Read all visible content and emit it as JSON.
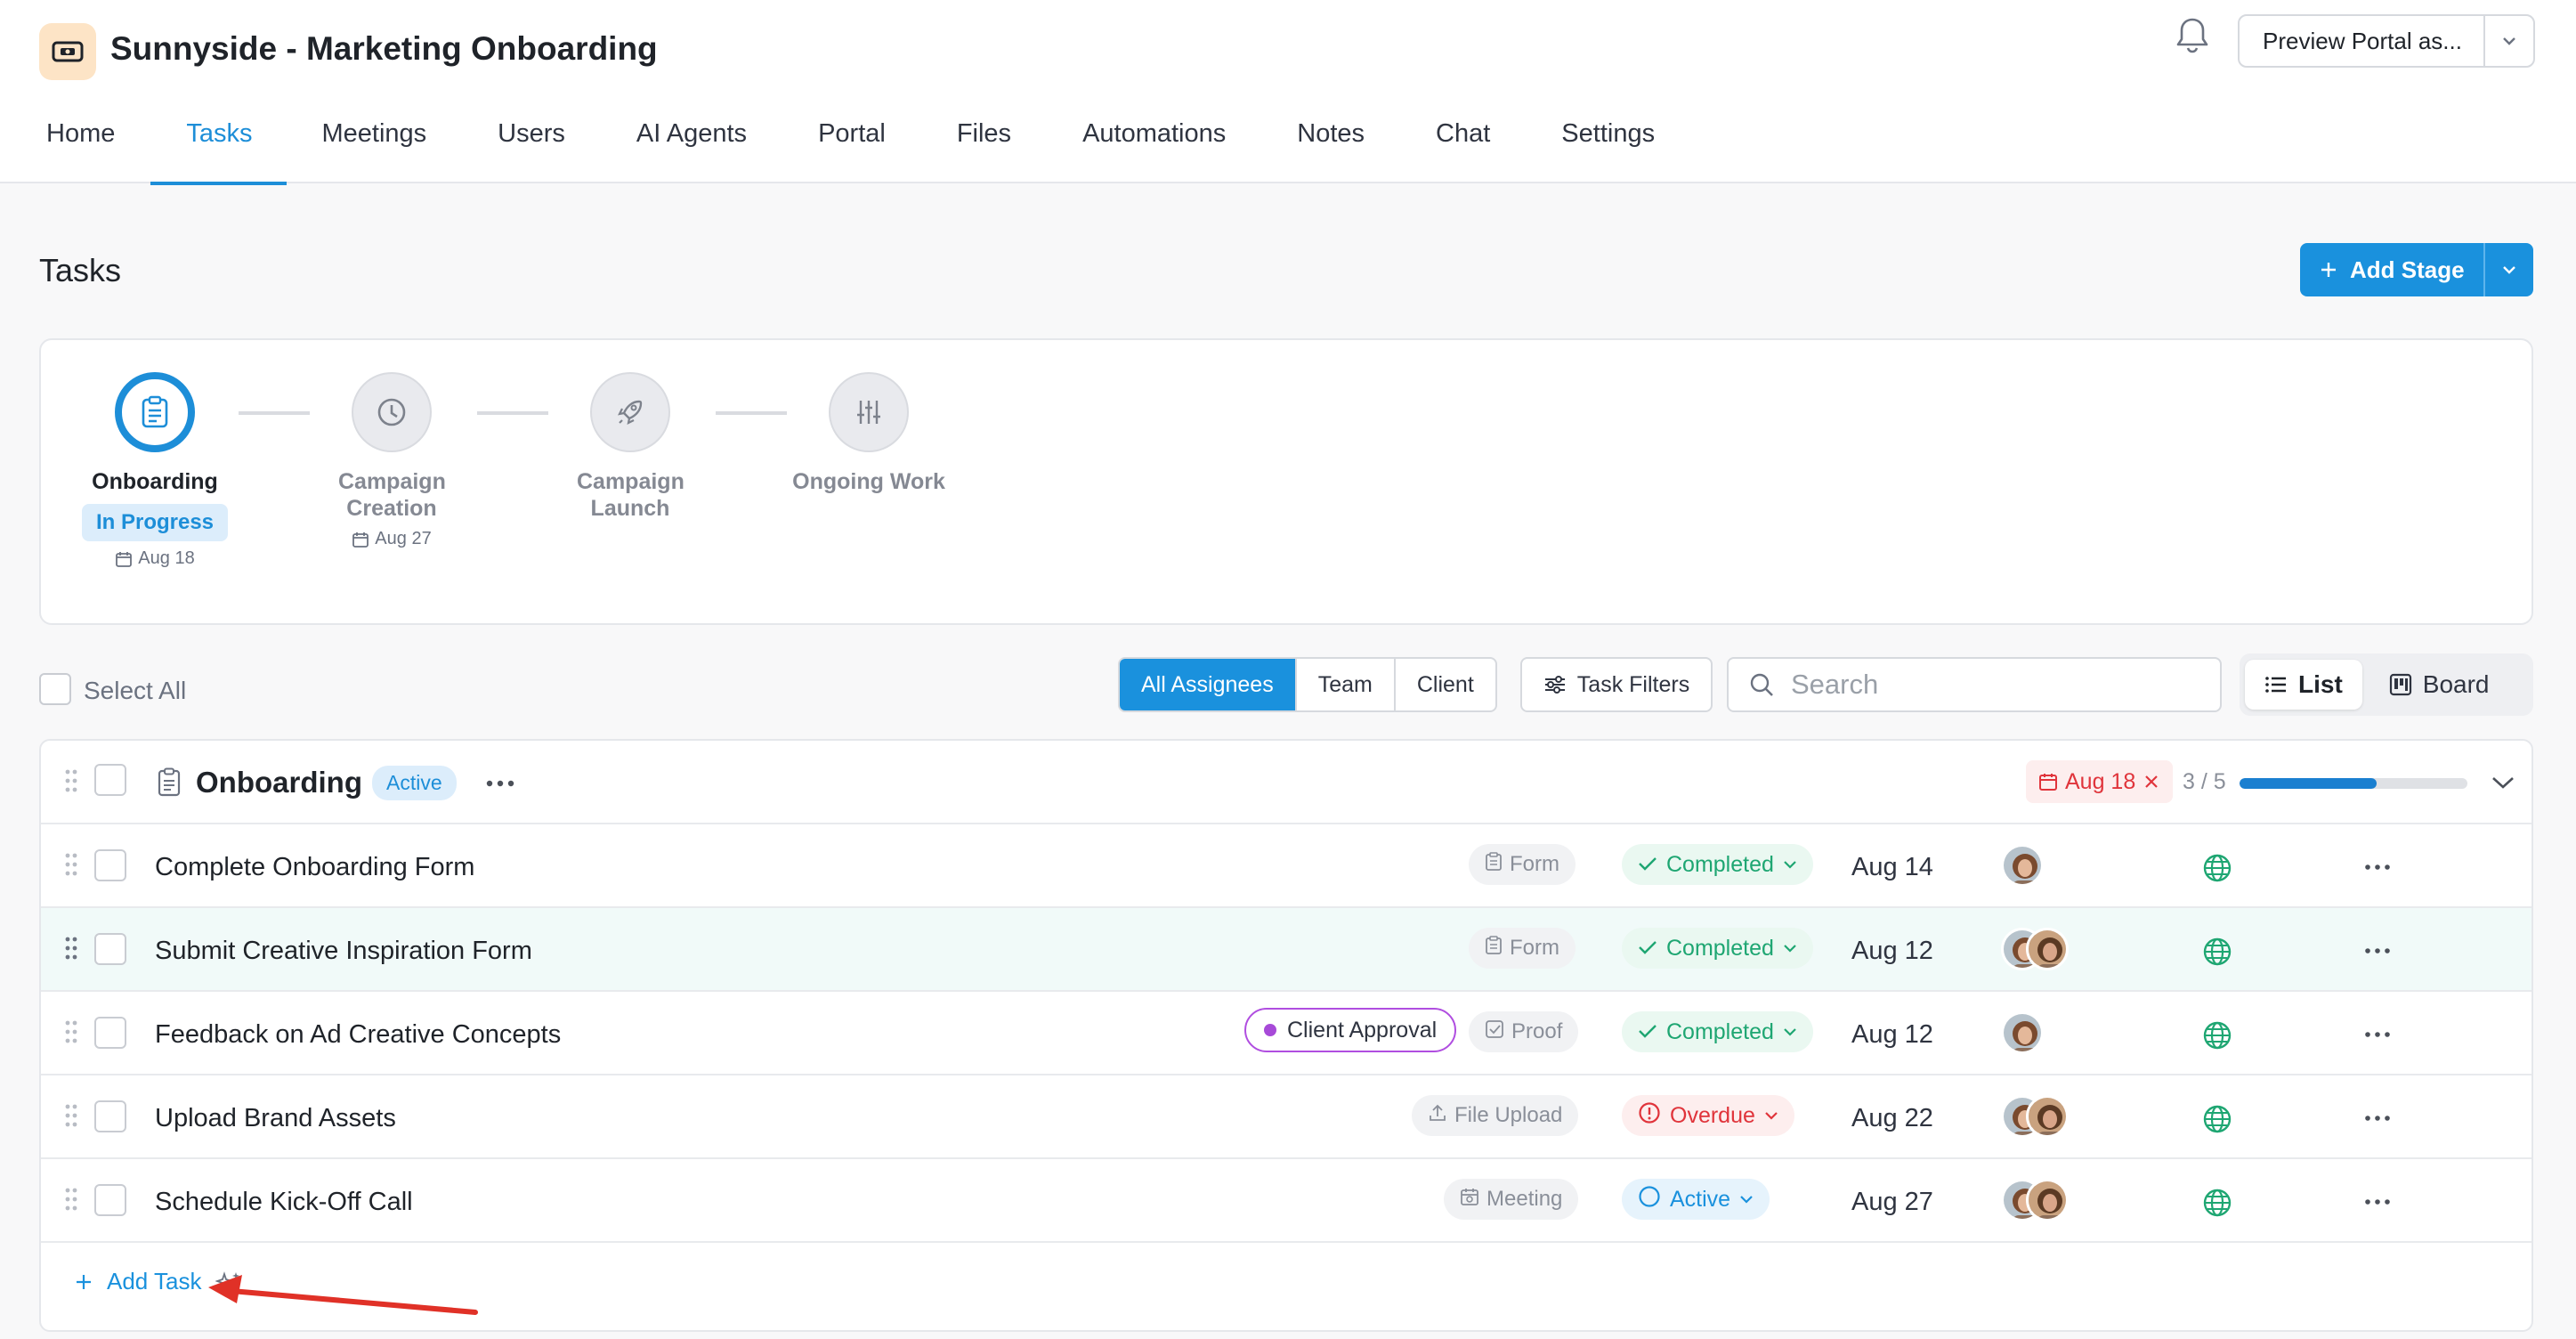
{
  "app": {
    "title": "Sunnyside - Marketing Onboarding"
  },
  "header": {
    "preview_label": "Preview Portal as...",
    "tabs": [
      {
        "label": "Home"
      },
      {
        "label": "Tasks",
        "active": true
      },
      {
        "label": "Meetings"
      },
      {
        "label": "Users"
      },
      {
        "label": "AI Agents"
      },
      {
        "label": "Portal"
      },
      {
        "label": "Files"
      },
      {
        "label": "Automations"
      },
      {
        "label": "Notes"
      },
      {
        "label": "Chat"
      },
      {
        "label": "Settings"
      }
    ]
  },
  "page": {
    "title": "Tasks",
    "add_stage_label": "Add Stage"
  },
  "stages": [
    {
      "name": "Onboarding",
      "status": "In Progress",
      "date": "Aug 18",
      "icon": "clipboard-icon",
      "current": true
    },
    {
      "name": "Campaign Creation",
      "date": "Aug 27",
      "icon": "clock-icon"
    },
    {
      "name": "Campaign Launch",
      "icon": "rocket-icon"
    },
    {
      "name": "Ongoing Work",
      "icon": "sliders-icon"
    }
  ],
  "toolbar": {
    "select_all": "Select All",
    "assignee_filters": [
      "All Assignees",
      "Team",
      "Client"
    ],
    "task_filters_label": "Task Filters",
    "search_placeholder": "Search",
    "views": [
      "List",
      "Board"
    ]
  },
  "group": {
    "title": "Onboarding",
    "badge": "Active",
    "due": "Aug 18",
    "progress_text": "3 / 5",
    "progress_fraction": 0.6,
    "add_task_label": "Add Task"
  },
  "tasks": [
    {
      "name": "Complete Onboarding Form",
      "type": "Form",
      "type_icon": "form-icon",
      "status": "Completed",
      "status_kind": "completed",
      "due": "Aug 14",
      "avatars": 1
    },
    {
      "name": "Submit Creative Inspiration Form",
      "type": "Form",
      "type_icon": "form-icon",
      "status": "Completed",
      "status_kind": "completed",
      "due": "Aug 12",
      "avatars": 2
    },
    {
      "name": "Feedback on Ad Creative Concepts",
      "tag": "Client Approval",
      "type": "Proof",
      "type_icon": "proof-icon",
      "status": "Completed",
      "status_kind": "completed",
      "due": "Aug 12",
      "avatars": 1
    },
    {
      "name": "Upload Brand Assets",
      "type": "File Upload",
      "type_icon": "upload-icon",
      "status": "Overdue",
      "status_kind": "overdue",
      "due": "Aug 22",
      "avatars": 2
    },
    {
      "name": "Schedule Kick-Off Call",
      "type": "Meeting",
      "type_icon": "calendar-icon",
      "status": "Active",
      "status_kind": "active",
      "due": "Aug 27",
      "avatars": 2
    }
  ],
  "colors": {
    "accent": "#1a91dd",
    "completed": "#1ea672",
    "overdue": "#e0343b",
    "client_tag": "#b04ee0"
  }
}
